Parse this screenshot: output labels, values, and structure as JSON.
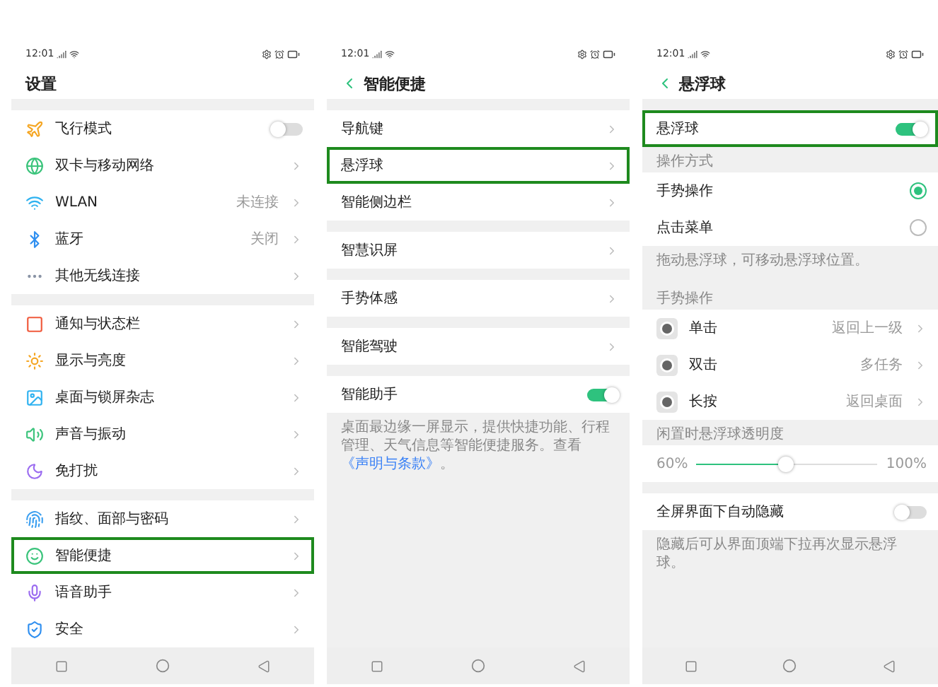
{
  "screens": [
    {
      "status_time": "12:01",
      "title": "设置",
      "back": false,
      "blocks": [
        {
          "kind": "group",
          "rows": [
            {
              "kind": "switch",
              "label": "飞行模式",
              "on": false,
              "highlighted": false
            },
            {
              "kind": "link",
              "label": "双卡与移动网络",
              "highlighted": false
            },
            {
              "kind": "link",
              "label": "WLAN",
              "value": "未连接",
              "highlighted": false
            },
            {
              "kind": "link",
              "label": "蓝牙",
              "value": "关闭",
              "highlighted": false
            },
            {
              "kind": "link",
              "label": "其他无线连接",
              "highlighted": false
            }
          ]
        },
        {
          "kind": "group",
          "rows": [
            {
              "kind": "link",
              "label": "通知与状态栏",
              "highlighted": false
            },
            {
              "kind": "link",
              "label": "显示与亮度",
              "highlighted": false
            },
            {
              "kind": "link",
              "label": "桌面与锁屏杂志",
              "highlighted": false
            },
            {
              "kind": "link",
              "label": "声音与振动",
              "highlighted": false
            },
            {
              "kind": "link",
              "label": "免打扰",
              "highlighted": false
            }
          ]
        },
        {
          "kind": "group",
          "rows": [
            {
              "kind": "link",
              "label": "指纹、面部与密码",
              "highlighted": false
            },
            {
              "kind": "link",
              "label": "智能便捷",
              "highlighted": true
            },
            {
              "kind": "link",
              "label": "语音助手",
              "highlighted": false
            },
            {
              "kind": "link",
              "label": "安全",
              "highlighted": false
            }
          ]
        }
      ]
    },
    {
      "status_time": "12:01",
      "title": "智能便捷",
      "back": true,
      "blocks": [
        {
          "kind": "group",
          "rows": [
            {
              "kind": "link",
              "label": "导航键",
              "highlighted": false
            },
            {
              "kind": "link",
              "label": "悬浮球",
              "highlighted": true
            },
            {
              "kind": "link",
              "label": "智能侧边栏",
              "highlighted": false
            }
          ]
        },
        {
          "kind": "group",
          "rows": [
            {
              "kind": "link",
              "label": "智慧识屏",
              "highlighted": false
            }
          ]
        },
        {
          "kind": "group",
          "rows": [
            {
              "kind": "link",
              "label": "手势体感",
              "highlighted": false
            }
          ]
        },
        {
          "kind": "group",
          "rows": [
            {
              "kind": "link",
              "label": "智能驾驶",
              "highlighted": false
            }
          ]
        },
        {
          "kind": "group",
          "rows": [
            {
              "kind": "switch",
              "label": "智能助手",
              "on": true,
              "highlighted": false
            }
          ]
        },
        {
          "kind": "note",
          "text": "桌面最边缘一屏显示，提供快捷功能、行程管理、天气信息等智能便捷服务。查看",
          "link": "《声明与条款》",
          "after": "。"
        }
      ]
    },
    {
      "status_time": "12:01",
      "title": "悬浮球",
      "back": true,
      "blocks": [
        {
          "kind": "group",
          "rows": [
            {
              "kind": "switch",
              "label": "悬浮球",
              "on": true,
              "highlighted": true
            }
          ]
        },
        {
          "kind": "caption",
          "text": "操作方式"
        },
        {
          "kind": "group",
          "rows": [
            {
              "kind": "radio",
              "label": "手势操作",
              "selected": true,
              "highlighted": false
            },
            {
              "kind": "radio",
              "label": "点击菜单",
              "selected": false,
              "highlighted": false
            }
          ]
        },
        {
          "kind": "note",
          "text": "拖动悬浮球，可移动悬浮球位置。"
        },
        {
          "kind": "caption",
          "text": "手势操作"
        },
        {
          "kind": "group",
          "rows": [
            {
              "kind": "gesture",
              "label": "单击",
              "value": "返回上一级",
              "highlighted": false
            },
            {
              "kind": "gesture",
              "label": "双击",
              "value": "多任务",
              "highlighted": false
            },
            {
              "kind": "gesture",
              "label": "长按",
              "value": "返回桌面",
              "highlighted": false
            }
          ]
        },
        {
          "kind": "caption",
          "text": "闲置时悬浮球透明度"
        },
        {
          "kind": "slider",
          "min_label": "60%",
          "max_label": "100%",
          "level": 0.49
        },
        {
          "kind": "group",
          "rows": [
            {
              "kind": "switch",
              "label": "全屏界面下自动隐藏",
              "on": false,
              "highlighted": false
            }
          ]
        },
        {
          "kind": "note",
          "text": "隐藏后可从界面顶端下拉再次显示悬浮球。"
        }
      ]
    }
  ]
}
